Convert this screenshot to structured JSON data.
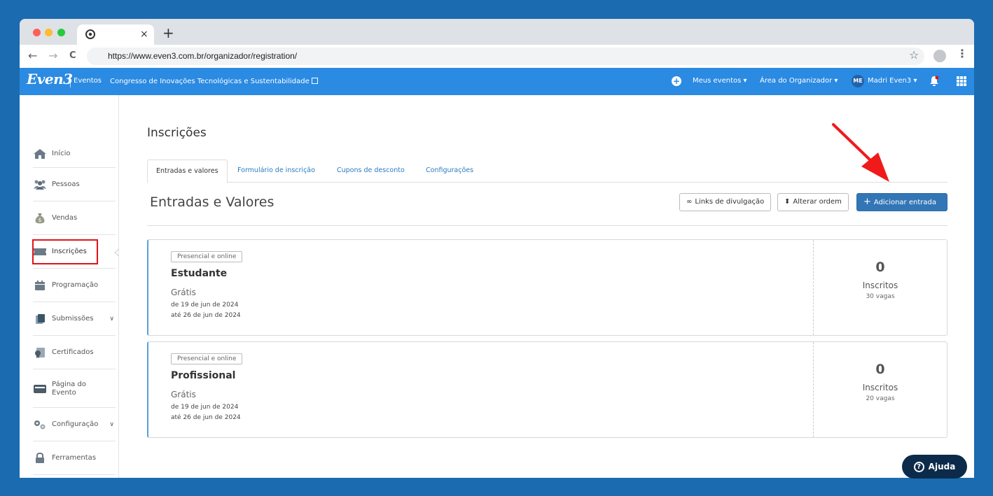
{
  "browser": {
    "tab_close": "×",
    "new_tab": "+",
    "back": "←",
    "forward": "→",
    "reload": "C",
    "url": "https://www.even3.com.br/organizador/registration/",
    "star": "☆",
    "menu": "⋮"
  },
  "navbar": {
    "logo": "Even3",
    "eventos": "Eventos",
    "event_name": "Congresso de Inovações Tecnológicas e Sustentabilidade",
    "plus": "+",
    "meus_eventos": "Meus eventos ▾",
    "area_organizador": "Área do Organizador ▾",
    "avatar_initials": "ME",
    "user_name": "Madri Even3 ▾"
  },
  "sidebar": {
    "items": [
      {
        "label": "Início",
        "icon": "home-icon"
      },
      {
        "label": "Pessoas",
        "icon": "people-icon"
      },
      {
        "label": "Vendas",
        "icon": "money-bag-icon"
      },
      {
        "label": "Inscrições",
        "icon": "ticket-icon"
      },
      {
        "label": "Programação",
        "icon": "calendar-icon"
      },
      {
        "label": "Submissões",
        "icon": "documents-icon",
        "chevron": "∨"
      },
      {
        "label": "Certificados",
        "icon": "certificate-icon"
      },
      {
        "label": "Página do Evento",
        "icon": "page-icon"
      },
      {
        "label": "Configuração",
        "icon": "gears-icon",
        "chevron": "∨"
      },
      {
        "label": "Ferramentas",
        "icon": "lock-icon"
      }
    ]
  },
  "main": {
    "page_title": "Inscrições",
    "tabs": [
      {
        "label": "Entradas e valores",
        "active": true
      },
      {
        "label": "Formulário de inscrição"
      },
      {
        "label": "Cupons de desconto"
      },
      {
        "label": "Configurações"
      }
    ],
    "section_title": "Entradas e Valores",
    "buttons": {
      "links": "Links de divulgação",
      "links_icon": "∞",
      "order": "Alterar ordem",
      "order_icon": "⬍",
      "add": "Adicionar entrada",
      "add_icon": "+"
    },
    "tickets": [
      {
        "badge": "Presencial e online",
        "name": "Estudante",
        "price": "Grátis",
        "date_start": "de 19 de jun de 2024",
        "date_end": "até 26 de jun de 2024",
        "count": "0",
        "count_label": "Inscritos",
        "vagas": "30 vagas"
      },
      {
        "badge": "Presencial e online",
        "name": "Profissional",
        "price": "Grátis",
        "date_start": "de 19 de jun de 2024",
        "date_end": "até 26 de jun de 2024",
        "count": "0",
        "count_label": "Inscritos",
        "vagas": "20 vagas"
      }
    ]
  },
  "help": {
    "icon": "?",
    "label": "Ajuda"
  },
  "colors": {
    "background": "#1b6bb0",
    "navbar": "#2b8ae2",
    "primary_button": "#3376b6",
    "highlight": "#e0141a",
    "help_button": "#0c2b4a"
  }
}
